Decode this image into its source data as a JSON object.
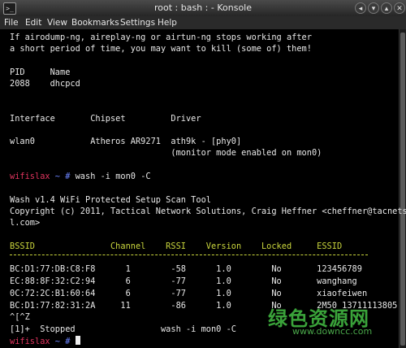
{
  "window": {
    "title": "root : bash : - Konsole",
    "app_icon": ">_",
    "controls": [
      "◂",
      "▾",
      "▴",
      "✕"
    ]
  },
  "menu": [
    "File",
    "Edit",
    "View",
    "Bookmarks",
    "Settings",
    "Help"
  ],
  "terminal": {
    "warning_line1": "If airodump-ng, aireplay-ng or airtun-ng stops working after",
    "warning_line2": "a short period of time, you may want to kill (some of) them!",
    "pid_header": "PID     Name",
    "pid_row": "2088    dhcpcd",
    "iface_header": "Interface       Chipset         Driver",
    "iface_row": "wlan0           Atheros AR9271  ath9k - [phy0]",
    "iface_note": "                                (monitor mode enabled on mon0)",
    "prompt_host": "wifislax",
    "prompt_sep": " ~ # ",
    "command": "wash -i mon0 -C",
    "wash_title": "Wash v1.4 WiFi Protected Setup Scan Tool",
    "copyright1": "Copyright (c) 2011, Tactical Network Solutions, Craig Heffner <cheffner@tacnetso",
    "copyright2": "l.com>",
    "table_header": "BSSID               Channel    RSSI    Version    Locked     ESSID",
    "rows": [
      "BC:D1:77:DB:C8:F8      1        -58      1.0        No       123456789",
      "EC:88:8F:32:C2:94      6        -77      1.0        No       wanghang",
      "0C:72:2C:B1:60:64      6        -77      1.0        No       xiaofeiwen",
      "BC:D1:77:82:31:2A     11        -86      1.0        No       2M50 13711113805"
    ],
    "ctrl_z": "^[^Z",
    "stopped": "[1]+  Stopped                 wash -i mon0 -C"
  },
  "watermark": {
    "cn": "绿色资源网",
    "url": "www.downcc.com"
  }
}
